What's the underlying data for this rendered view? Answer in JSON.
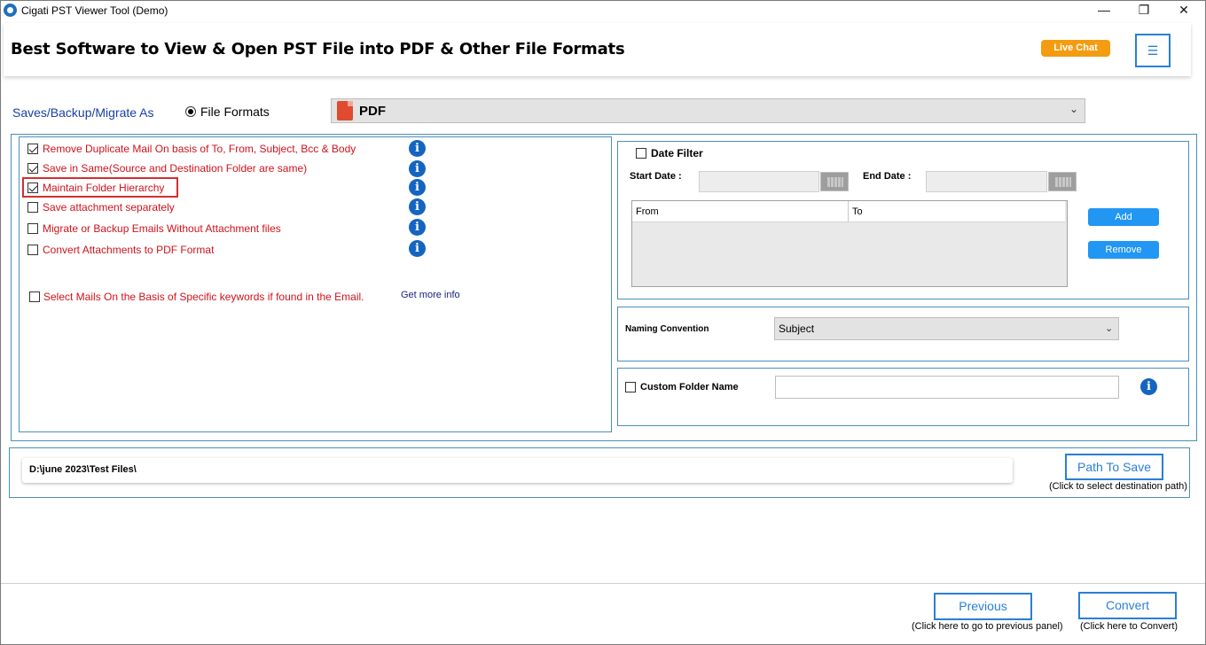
{
  "window": {
    "title": "Cigati PST Viewer Tool (Demo)",
    "minimize": "—",
    "maximize": "❐",
    "close": "✕"
  },
  "banner": {
    "title": "Best Software to View & Open PST File into PDF & Other File Formats",
    "live_chat": "Live Chat",
    "menu": "☰"
  },
  "saves": {
    "label": "Saves/Backup/Migrate As",
    "radio_label": "File Formats",
    "selected_format": "PDF",
    "chevron": "⌄"
  },
  "options": [
    {
      "label": "Remove Duplicate Mail On basis of To, From, Subject, Bcc & Body",
      "checked": true
    },
    {
      "label": "Save in Same(Source and Destination Folder are same)",
      "checked": true
    },
    {
      "label": "Maintain Folder Hierarchy",
      "checked": true
    },
    {
      "label": "Save attachment separately",
      "checked": false
    },
    {
      "label": "Migrate or Backup Emails Without Attachment files",
      "checked": false
    },
    {
      "label": "Convert Attachments to PDF Format",
      "checked": false
    }
  ],
  "keywords": {
    "label": "Select Mails On the Basis of Specific keywords if found in the Email.",
    "checked": false,
    "link": "Get more info"
  },
  "info_glyph": "i",
  "date_filter": {
    "label": "Date Filter",
    "start_label": "Start Date :",
    "end_label": "End Date :",
    "col_from": "From",
    "col_to": "To",
    "add": "Add",
    "remove": "Remove"
  },
  "naming": {
    "label": "Naming Convention",
    "value": "Subject"
  },
  "custom_folder": {
    "label": "Custom Folder Name",
    "value": ""
  },
  "path": {
    "value": "D:\\june 2023\\Test Files\\",
    "button": "Path To Save",
    "hint": "(Click to select destination path)"
  },
  "footer": {
    "previous": "Previous",
    "previous_hint": "(Click here to go to previous panel)",
    "convert": "Convert",
    "convert_hint": "(Click here to Convert)"
  },
  "colors": {
    "accent": "#2a7fd4",
    "option_text": "#d0121b",
    "live_chat": "#f39c12",
    "info": "#1565c0",
    "panel_border": "#4a90b8"
  }
}
